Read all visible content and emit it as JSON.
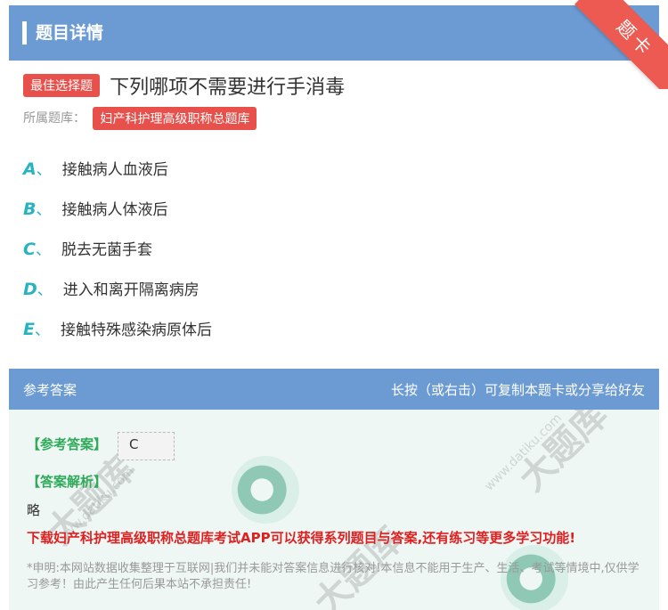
{
  "header": {
    "title": "题目详情"
  },
  "ribbon": {
    "label": "题卡"
  },
  "question": {
    "type_badge": "最佳选择题",
    "text": "下列哪项不需要进行手消毒",
    "bank_label": "所属题库：",
    "bank_name": "妇产科护理高级职称总题库"
  },
  "options": [
    {
      "letter": "A",
      "sep": "、",
      "text": "接触病人血液后"
    },
    {
      "letter": "B",
      "sep": "、",
      "text": "接触病人体液后"
    },
    {
      "letter": "C",
      "sep": "、",
      "text": "脱去无菌手套"
    },
    {
      "letter": "D",
      "sep": "、",
      "text": "进入和离开隔离病房"
    },
    {
      "letter": "E",
      "sep": "、",
      "text": "接触特殊感染病原体后"
    }
  ],
  "answer_section": {
    "title": "参考答案",
    "hint": "长按（或右击）可复制本题卡或分享给好友",
    "answer_label": "【参考答案】",
    "answer_value": "C",
    "analysis_label": "【答案解析】",
    "analysis_text": "略",
    "promo": "下载妇产科护理高级职称总题库考试APP可以获得系列题目与答案,还有练习等更多学习功能!",
    "disclaimer": "*申明:本网站数据收集整理于互联网|我们并未能对答案信息进行核对!本信息不能用于生产、生活、考试等情境中,仅供学习参考！由此产生任何后果本站不承担责任!"
  },
  "watermark": {
    "text": "大题库",
    "url": "www.datiku.com"
  },
  "colors": {
    "header": "#6b9bd2",
    "badge": "#e8504b",
    "option_letter": "#27b3c0",
    "promo": "#e02020"
  }
}
